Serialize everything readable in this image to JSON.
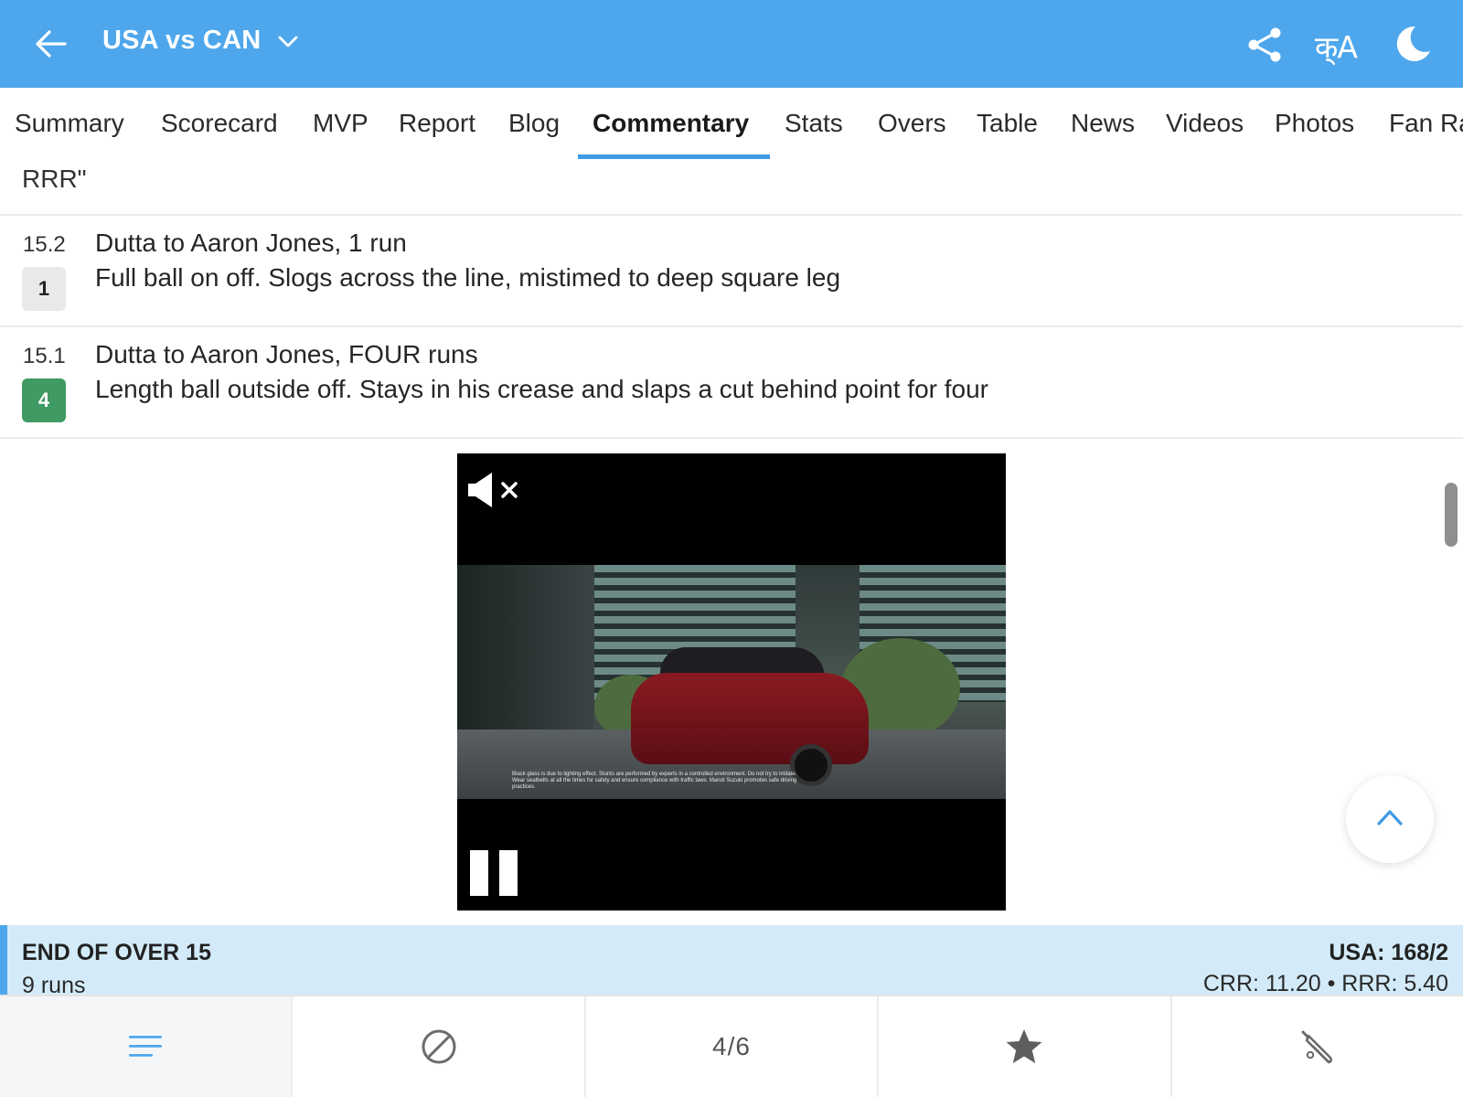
{
  "header": {
    "title": "USA vs CAN",
    "lang_label": "क्A",
    "bg_color": "#4ea7ec"
  },
  "tabs": [
    {
      "label": "Summary"
    },
    {
      "label": "Scorecard"
    },
    {
      "label": "MVP"
    },
    {
      "label": "Report"
    },
    {
      "label": "Blog"
    },
    {
      "label": "Commentary",
      "active": true
    },
    {
      "label": "Stats"
    },
    {
      "label": "Overs"
    },
    {
      "label": "Table"
    },
    {
      "label": "News"
    },
    {
      "label": "Videos"
    },
    {
      "label": "Photos"
    },
    {
      "label": "Fan Ra"
    }
  ],
  "truncated_text": "RRR\"",
  "commentary": [
    {
      "over_ball": "15.2",
      "runs_badge": "1",
      "badge_type": "dot",
      "title": "Dutta to Aaron Jones, 1 run",
      "description": "Full ball on off. Slogs across the line, mistimed to deep square leg"
    },
    {
      "over_ball": "15.1",
      "runs_badge": "4",
      "badge_type": "four",
      "title": "Dutta to Aaron Jones, FOUR runs",
      "description": "Length ball outside off. Stays in his crease and slaps a cut behind point for four"
    }
  ],
  "video_ad": {
    "disclaimer": "Black glass is due to lighting effect. Stunts are performed by experts in a controlled environment. Do not try to imitate. Wear seatbelts at all the times for safety and ensure compliance with traffic laws. Maruti Suzuki promotes safe driving practices.",
    "muted": true,
    "playing": true
  },
  "end_of_over": {
    "title": "END OF OVER 15",
    "runs": "9 runs",
    "score": "USA: 168/2",
    "rates": "CRR: 11.20 • RRR: 5.40"
  },
  "bottom_nav": {
    "items": [
      "menu-icon",
      "ball-icon",
      "page-indicator",
      "star-icon",
      "bat-icon"
    ],
    "page_indicator": "4/6",
    "active_index": 0
  },
  "colors": {
    "accent": "#4ea7ec",
    "tab_underline": "#3e9be6",
    "four_badge": "#3f9a63",
    "over_summary_bg": "#d3ebf8"
  }
}
